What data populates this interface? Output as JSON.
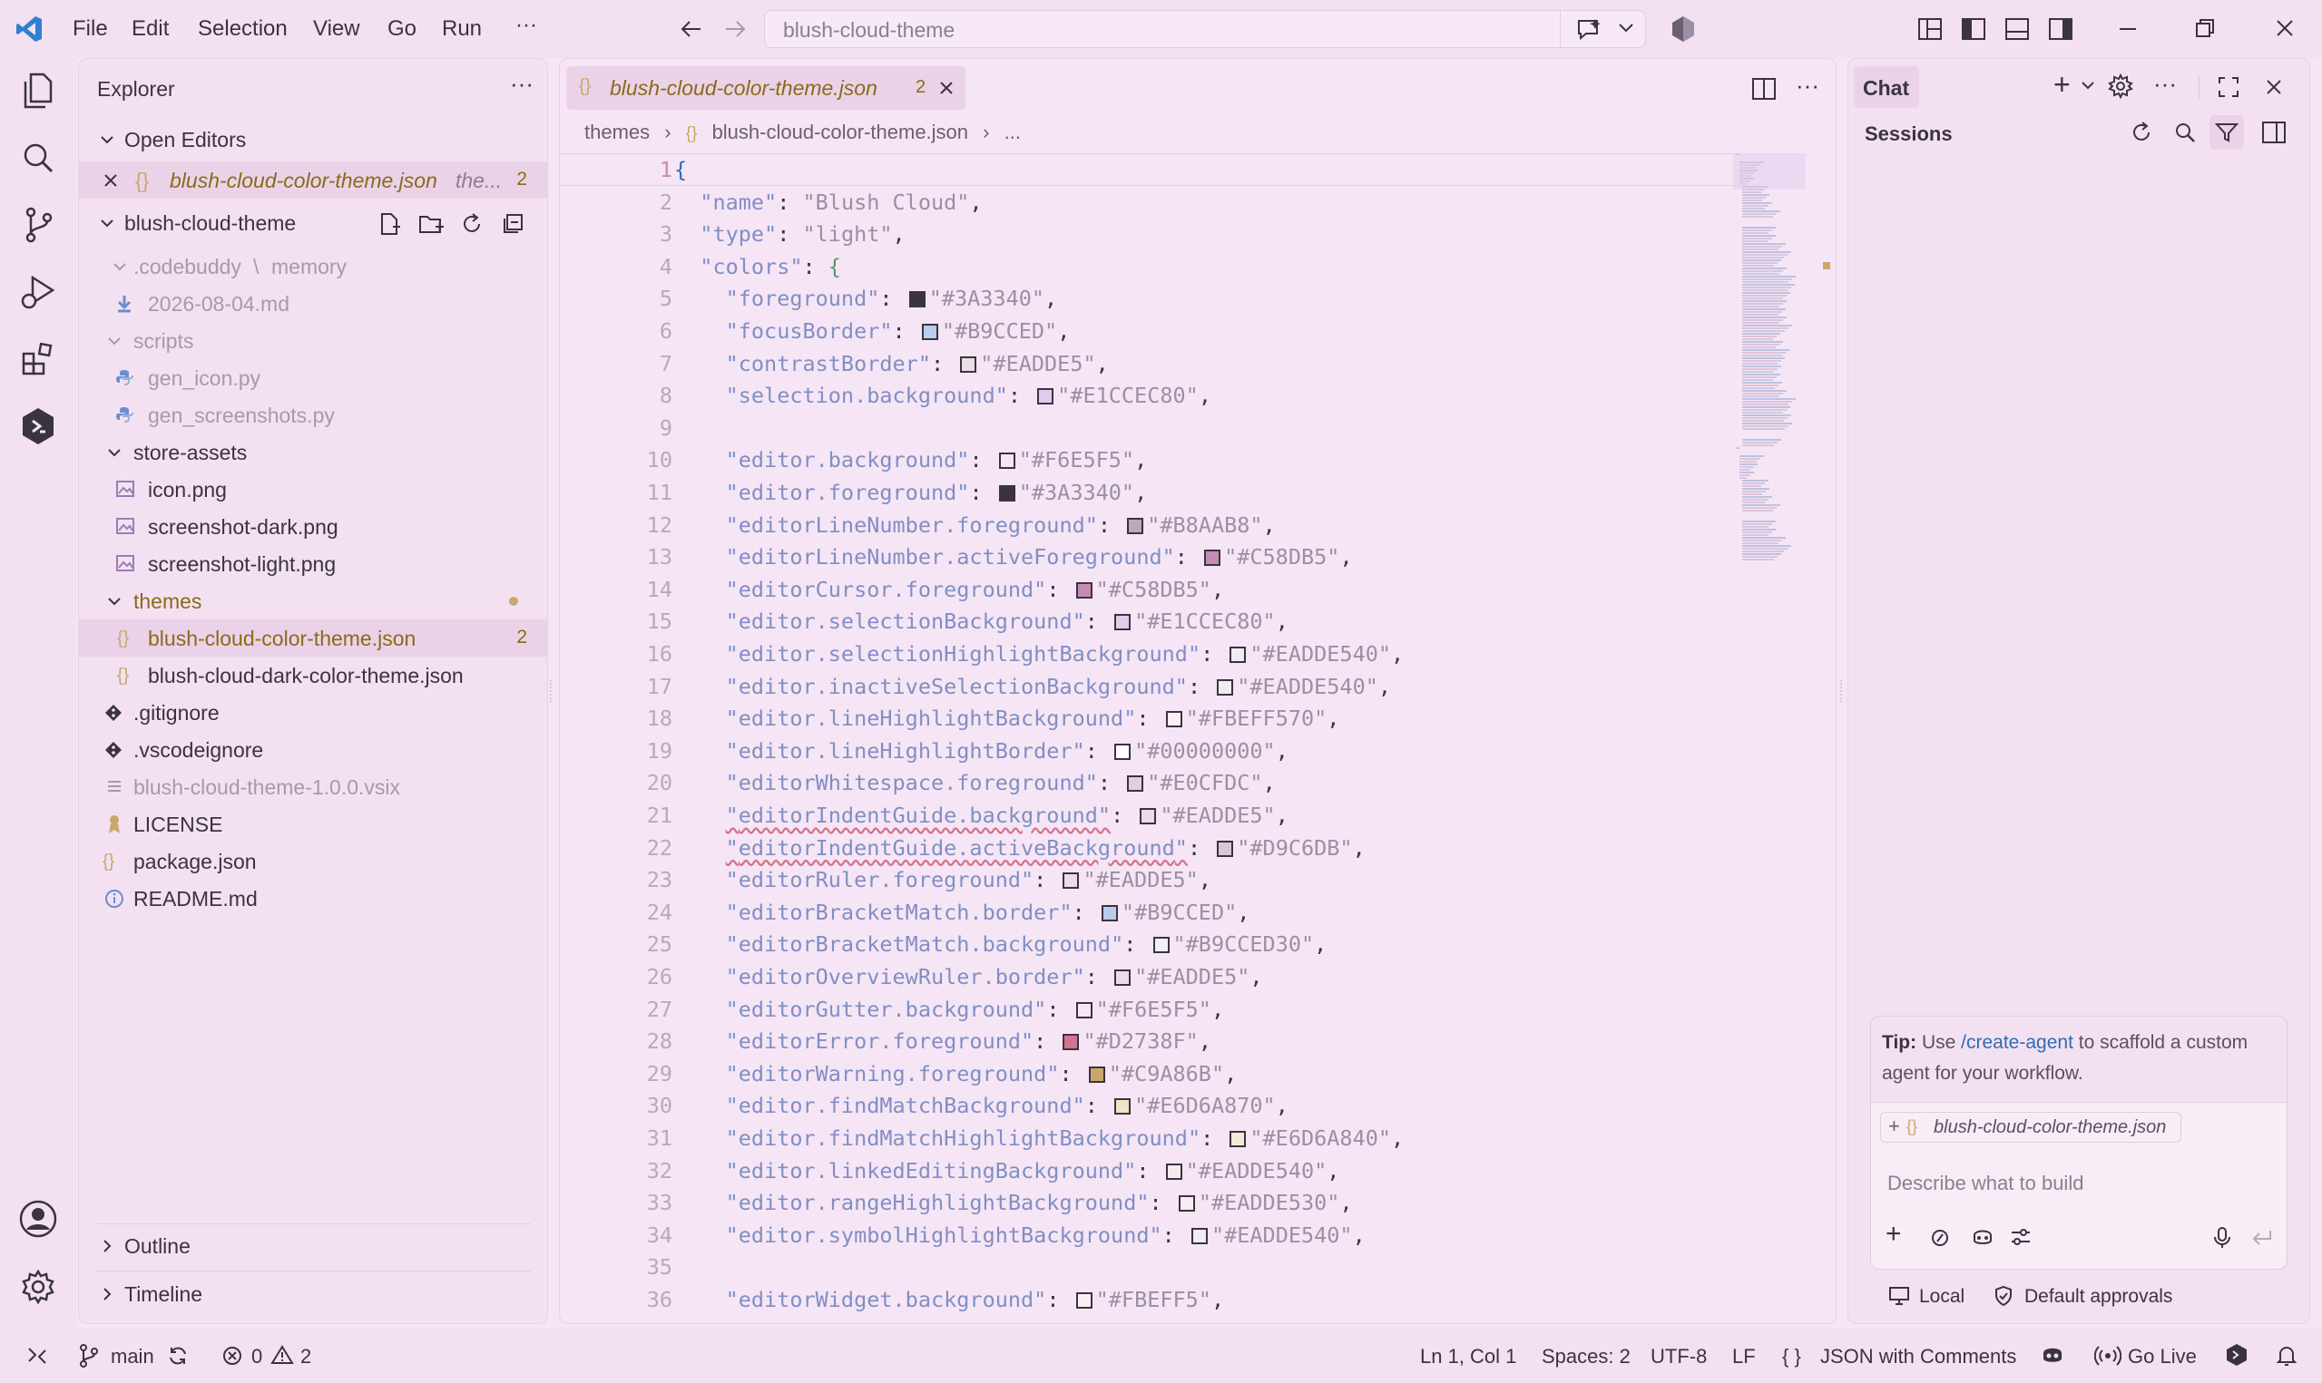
{
  "titlebar": {
    "menu": [
      "File",
      "Edit",
      "Selection",
      "View",
      "Go",
      "Run",
      "···"
    ],
    "search_text": "blush-cloud-theme"
  },
  "sidebar": {
    "title": "Explorer",
    "open_editors_label": "Open Editors",
    "open_editor_file": "blush-cloud-color-theme.json",
    "open_editor_hint": "the...",
    "open_editor_count": "2",
    "project_label": "blush-cloud-theme",
    "items": [
      {
        "label": ".codebuddy",
        "sub": "memory",
        "type": "folder",
        "muted": true
      },
      {
        "label": "2026-08-04.md",
        "type": "md",
        "muted": true
      },
      {
        "label": "scripts",
        "type": "folder",
        "muted": true
      },
      {
        "label": "gen_icon.py",
        "type": "py",
        "muted": true
      },
      {
        "label": "gen_screenshots.py",
        "type": "py",
        "muted": true
      },
      {
        "label": "store-assets",
        "type": "folder"
      },
      {
        "label": "icon.png",
        "type": "img"
      },
      {
        "label": "screenshot-dark.png",
        "type": "img"
      },
      {
        "label": "screenshot-light.png",
        "type": "img"
      },
      {
        "label": "themes",
        "type": "folder"
      },
      {
        "label": "blush-cloud-color-theme.json",
        "type": "json",
        "count": "2"
      },
      {
        "label": "blush-cloud-dark-color-theme.json",
        "type": "json"
      },
      {
        "label": ".gitignore",
        "type": "git"
      },
      {
        "label": ".vscodeignore",
        "type": "git"
      },
      {
        "label": "blush-cloud-theme-1.0.0.vsix",
        "type": "file",
        "muted": true
      },
      {
        "label": "LICENSE",
        "type": "license"
      },
      {
        "label": "package.json",
        "type": "json"
      },
      {
        "label": "README.md",
        "type": "info"
      }
    ],
    "outline_label": "Outline",
    "timeline_label": "Timeline"
  },
  "editor": {
    "tab_label": "blush-cloud-color-theme.json",
    "tab_count": "2",
    "breadcrumb": [
      "themes",
      "blush-cloud-color-theme.json",
      "..."
    ],
    "lines": [
      {
        "n": "1",
        "raw": "{"
      },
      {
        "n": "2",
        "key": "name",
        "val": "\"Blush Cloud\"",
        "indent": 1
      },
      {
        "n": "3",
        "key": "type",
        "val": "\"light\"",
        "indent": 1
      },
      {
        "n": "4",
        "key": "colors",
        "val": "{",
        "indent": 1,
        "open": true
      },
      {
        "n": "5",
        "key": "foreground",
        "val": "\"#3A3340\"",
        "color": "#3A3340",
        "indent": 2
      },
      {
        "n": "6",
        "key": "focusBorder",
        "val": "\"#B9CCED\"",
        "color": "#B9CCED",
        "indent": 2
      },
      {
        "n": "7",
        "key": "contrastBorder",
        "val": "\"#EADDE5\"",
        "color": "#EADDE5",
        "indent": 2
      },
      {
        "n": "8",
        "key": "selection.background",
        "val": "\"#E1CCEC80\"",
        "color": "#E1CCEC",
        "indent": 2
      },
      {
        "n": "9",
        "raw": ""
      },
      {
        "n": "10",
        "key": "editor.background",
        "val": "\"#F6E5F5\"",
        "color": "#F6E5F5",
        "indent": 2
      },
      {
        "n": "11",
        "key": "editor.foreground",
        "val": "\"#3A3340\"",
        "color": "#3A3340",
        "indent": 2
      },
      {
        "n": "12",
        "key": "editorLineNumber.foreground",
        "val": "\"#B8AAB8\"",
        "color": "#B8AAB8",
        "indent": 2
      },
      {
        "n": "13",
        "key": "editorLineNumber.activeForeground",
        "val": "\"#C58DB5\"",
        "color": "#C58DB5",
        "indent": 2
      },
      {
        "n": "14",
        "key": "editorCursor.foreground",
        "val": "\"#C58DB5\"",
        "color": "#C58DB5",
        "indent": 2
      },
      {
        "n": "15",
        "key": "editor.selectionBackground",
        "val": "\"#E1CCEC80\"",
        "color": "#E1CCEC",
        "indent": 2
      },
      {
        "n": "16",
        "key": "editor.selectionHighlightBackground",
        "val": "\"#EADDE540\"",
        "color": "#F2EBF0",
        "indent": 2
      },
      {
        "n": "17",
        "key": "editor.inactiveSelectionBackground",
        "val": "\"#EADDE540\"",
        "color": "#F2EBF0",
        "indent": 2
      },
      {
        "n": "18",
        "key": "editor.lineHighlightBackground",
        "val": "\"#FBEFF570\"",
        "color": "#FBEFF5",
        "indent": 2
      },
      {
        "n": "19",
        "key": "editor.lineHighlightBorder",
        "val": "\"#00000000\"",
        "color": "#FFFFFF",
        "indent": 2
      },
      {
        "n": "20",
        "key": "editorWhitespace.foreground",
        "val": "\"#E0CFDC\"",
        "color": "#E0CFDC",
        "indent": 2
      },
      {
        "n": "21",
        "key": "editorIndentGuide.background",
        "val": "\"#EADDE5\"",
        "color": "#EADDE5",
        "indent": 2,
        "squig": true
      },
      {
        "n": "22",
        "key": "editorIndentGuide.activeBackground",
        "val": "\"#D9C6DB\"",
        "color": "#D9C6DB",
        "indent": 2,
        "squig": true
      },
      {
        "n": "23",
        "key": "editorRuler.foreground",
        "val": "\"#EADDE5\"",
        "color": "#EADDE5",
        "indent": 2
      },
      {
        "n": "24",
        "key": "editorBracketMatch.border",
        "val": "\"#B9CCED\"",
        "color": "#B9CCED",
        "indent": 2
      },
      {
        "n": "25",
        "key": "editorBracketMatch.background",
        "val": "\"#B9CCED30\"",
        "color": "#EDF1FA",
        "indent": 2
      },
      {
        "n": "26",
        "key": "editorOverviewRuler.border",
        "val": "\"#EADDE5\"",
        "color": "#EADDE5",
        "indent": 2
      },
      {
        "n": "27",
        "key": "editorGutter.background",
        "val": "\"#F6E5F5\"",
        "color": "#F6E5F5",
        "indent": 2
      },
      {
        "n": "28",
        "key": "editorError.foreground",
        "val": "\"#D2738F\"",
        "color": "#D2738F",
        "indent": 2
      },
      {
        "n": "29",
        "key": "editorWarning.foreground",
        "val": "\"#C9A86B\"",
        "color": "#C9A86B",
        "indent": 2
      },
      {
        "n": "30",
        "key": "editor.findMatchBackground",
        "val": "\"#E6D6A870\"",
        "color": "#EEE3C4",
        "indent": 2
      },
      {
        "n": "31",
        "key": "editor.findMatchHighlightBackground",
        "val": "\"#E6D6A840\"",
        "color": "#F3EBD6",
        "indent": 2
      },
      {
        "n": "32",
        "key": "editor.linkedEditingBackground",
        "val": "\"#EADDE540\"",
        "color": "#F2EBF0",
        "indent": 2
      },
      {
        "n": "33",
        "key": "editor.rangeHighlightBackground",
        "val": "\"#EADDE530\"",
        "color": "#F4EEF2",
        "indent": 2
      },
      {
        "n": "34",
        "key": "editor.symbolHighlightBackground",
        "val": "\"#EADDE540\"",
        "color": "#F2EBF0",
        "indent": 2
      },
      {
        "n": "35",
        "raw": ""
      },
      {
        "n": "36",
        "key": "editorWidget.background",
        "val": "\"#FBEFF5\"",
        "color": "#FBEFF5",
        "indent": 2
      }
    ]
  },
  "chat": {
    "title": "Chat",
    "sessions_label": "Sessions",
    "tip_bold": "Tip:",
    "tip_pre": "Use",
    "tip_link": "/create-agent",
    "tip_post": "to scaffold a custom agent for your workflow.",
    "context_file": "blush-cloud-color-theme.json",
    "input_placeholder": "Describe what to build",
    "local_label": "Local",
    "approvals_label": "Default approvals"
  },
  "statusbar": {
    "branch": "main",
    "errors": "0",
    "warnings": "2",
    "position": "Ln 1, Col 1",
    "spaces": "Spaces: 2",
    "encoding": "UTF-8",
    "eol": "LF",
    "language": "JSON with Comments",
    "golive": "Go Live"
  },
  "colors": {
    "accent": "#C58DB5",
    "key": "#7F8FC4",
    "string": "#9A8FA6",
    "error": "#D2738F",
    "warning": "#C9A86B",
    "link": "#2F6BB5"
  }
}
